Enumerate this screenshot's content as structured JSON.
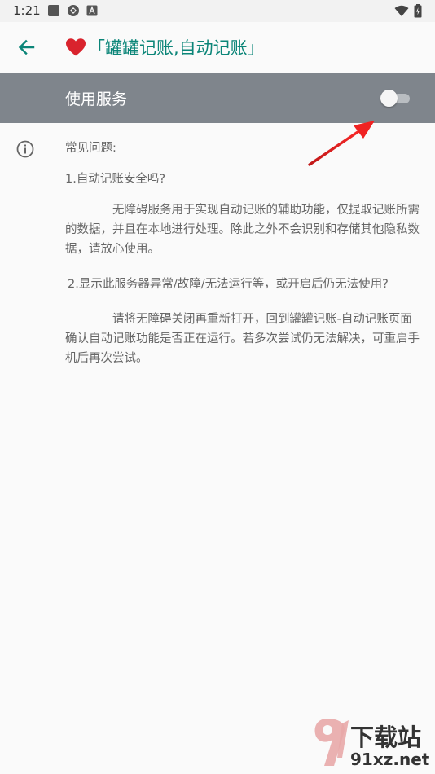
{
  "status_bar": {
    "time": "1:21"
  },
  "app_bar": {
    "title": "「罐罐记账,自动记账」"
  },
  "service": {
    "label": "使用服务",
    "enabled": false
  },
  "faq": {
    "heading": "常见问题:",
    "q1": "1.自动记账安全吗?",
    "a1": "无障碍服务用于实现自动记账的辅助功能，仅提取记账所需的数据，并且在本地进行处理。除此之外不会识别和存储其他隐私数据，请放心使用。",
    "q2": "2.显示此服务器异常/故障/无法运行等，或开启后仍无法使用?",
    "a2": "请将无障碍关闭再重新打开，回到罐罐记账-自动记账页面确认自动记账功能是否正在运行。若多次尝试仍无法解决，可重启手机后再次尝试。"
  },
  "watermark": {
    "title": "下载站",
    "url": "91xz.net"
  },
  "colors": {
    "accent": "#0b8578",
    "switch_bar": "#7f858c",
    "heart": "#d9232d",
    "arrow": "#e02020"
  }
}
